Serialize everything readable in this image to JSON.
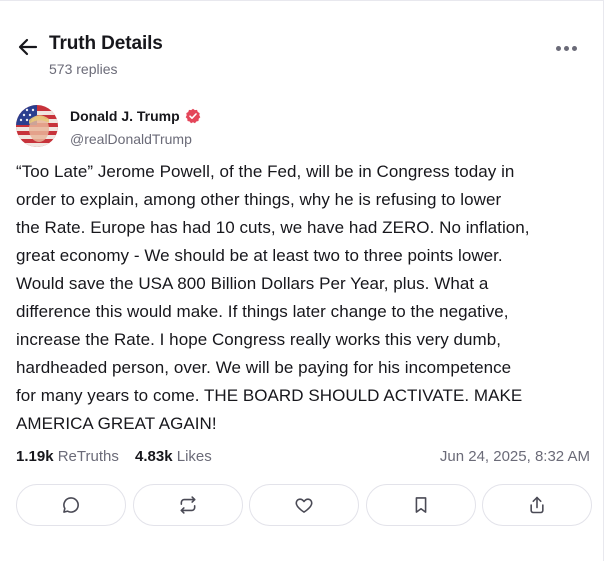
{
  "header": {
    "title": "Truth Details",
    "replies": "573 replies"
  },
  "post": {
    "author_name": "Donald J. Trump",
    "handle": "@realDonaldTrump",
    "text": "“Too Late” Jerome Powell, of the Fed, will be in Congress today in\norder to explain, among other things, why he is refusing to lower\nthe Rate. Europe has had 10 cuts, we have had ZERO. No inflation,\ngreat economy - We should be at least two to three points lower.\nWould save the USA 800 Billion Dollars Per Year, plus. What a\ndifference this would make. If things later change to the negative,\nincrease the Rate. I hope Congress really works this very dumb,\nhardheaded person, over. We will be paying for his incompetence\nfor many years to come. THE BOARD SHOULD ACTIVATE. MAKE\nAMERICA GREAT AGAIN!",
    "retruths_count": "1.19k",
    "retruths_label": "ReTruths",
    "likes_count": "4.83k",
    "likes_label": "Likes",
    "timestamp": "Jun 24, 2025, 8:32 AM"
  },
  "actions": [
    "reply-icon",
    "retruth-icon",
    "like-icon",
    "bookmark-icon",
    "share-icon"
  ],
  "colors": {
    "verified_badge": "#e4465a",
    "muted_text": "#6b6b78",
    "border": "#e3e3ea"
  }
}
